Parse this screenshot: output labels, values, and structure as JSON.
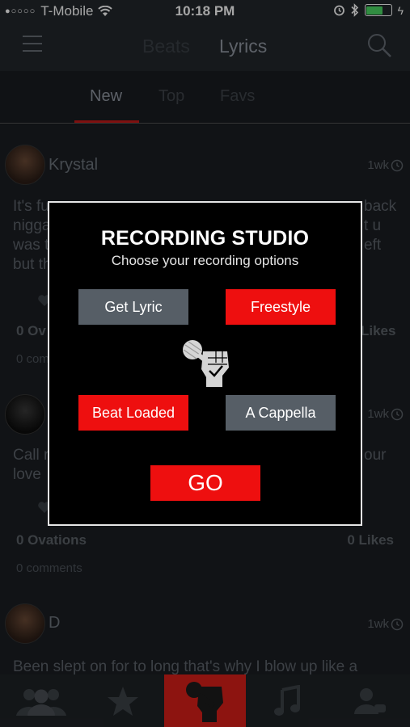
{
  "status_bar": {
    "carrier": "T-Mobile",
    "time": "10:18 PM",
    "battery_level": 0.7
  },
  "header": {
    "tabs": [
      "Beats",
      "Lyrics"
    ],
    "active_tab": "Lyrics",
    "menu_icon": "hamburger-icon",
    "search_icon": "search-icon"
  },
  "subtabs": {
    "items": [
      "New",
      "Top",
      "Favs"
    ],
    "active": "New"
  },
  "feed": {
    "posts": [
      {
        "name": "Krystal",
        "time": "1wk",
        "text_visible_left": [
          "It's fu",
          "nigga",
          "was t",
          "but th"
        ],
        "text_visible_right": [
          "back",
          "t u",
          "eft"
        ],
        "ovations": "0 Ov",
        "likes": "Likes",
        "comments": "0 com"
      },
      {
        "name": "",
        "time": "1wk",
        "text_visible_left": [
          "Call r",
          "love"
        ],
        "text_visible_right": [
          "our"
        ],
        "ovations": "0 Ovations",
        "likes": "0 Likes",
        "comments": "0 comments"
      },
      {
        "name": "D",
        "time": "1wk",
        "text": "Been slept on for to long that's why I blow up like a"
      }
    ]
  },
  "modal": {
    "title": "RECORDING STUDIO",
    "subtitle": "Choose your recording options",
    "options": {
      "get_lyric": "Get Lyric",
      "freestyle": "Freestyle",
      "beat_loaded": "Beat Loaded",
      "a_cappella": "A Cappella"
    },
    "go_label": "GO",
    "colors": {
      "selected": "#ee0f0f",
      "unselected": "#565e66"
    }
  },
  "bottom_nav": {
    "items": [
      "community-icon",
      "star-icon",
      "mic-fist-icon",
      "music-note-icon",
      "chat-user-icon"
    ],
    "active": "mic-fist-icon"
  }
}
